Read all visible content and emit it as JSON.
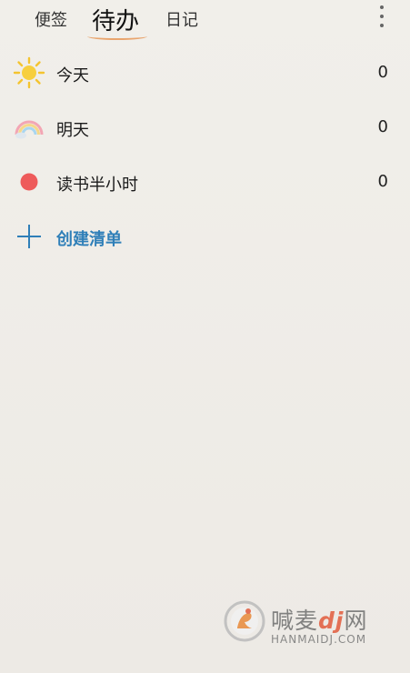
{
  "tabs": {
    "notes": "便签",
    "todo": "待办",
    "diary": "日记"
  },
  "lists": [
    {
      "label": "今天",
      "count": "0",
      "icon": "sun-icon"
    },
    {
      "label": "明天",
      "count": "0",
      "icon": "rainbow-icon"
    },
    {
      "label": "读书半小时",
      "count": "0",
      "icon": "red-dot-icon",
      "color": "#ee5b5b"
    }
  ],
  "create": {
    "label": "创建清单",
    "icon": "plus-icon",
    "color": "#2f7fb8"
  },
  "watermark": {
    "title_pre": "喊麦",
    "title_accent": "dj",
    "title_post": "网",
    "sub": "HANMAIDJ.COM"
  },
  "colors": {
    "background": "#efede8",
    "tab_underline": "#e9a56e",
    "accent_blue": "#2f7fb8"
  }
}
